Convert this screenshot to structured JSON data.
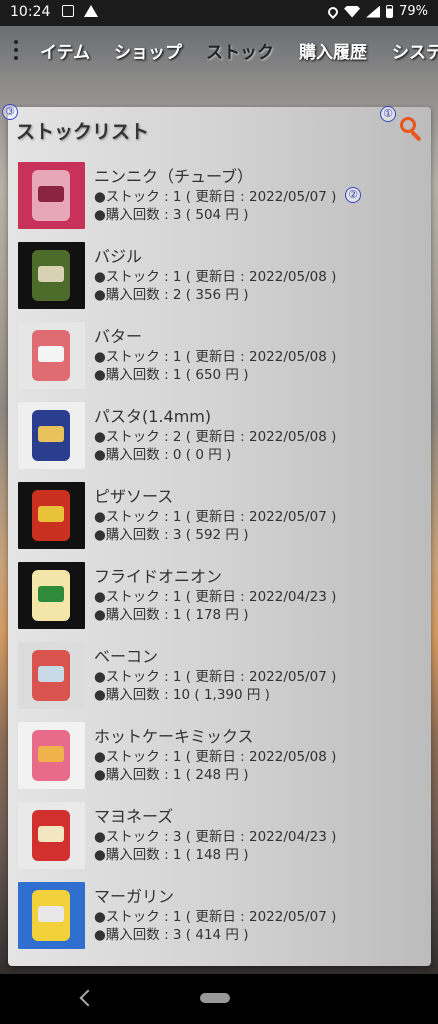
{
  "status": {
    "time": "10:24",
    "battery": "79%"
  },
  "tabs": [
    {
      "label": "イテム"
    },
    {
      "label": "ショップ"
    },
    {
      "label": "ストック",
      "active": true
    },
    {
      "label": "購入履歴"
    },
    {
      "label": "システ"
    }
  ],
  "panel": {
    "title": "ストックリスト",
    "markers": [
      "①",
      "②",
      "③"
    ]
  },
  "items": [
    {
      "name": "ニンニク（チューブ）",
      "stock": "●ストック : 1 ( 更新日 : 2022/05/07 )",
      "purchases": "●購入回数 : 3 ( 504 円 )",
      "thumb_colors": [
        "#c8325a",
        "#e8a7b8",
        "#8a2440"
      ]
    },
    {
      "name": "バジル",
      "stock": "●ストック : 1 ( 更新日 : 2022/05/08 )",
      "purchases": "●購入回数 : 2 ( 356 円 )",
      "thumb_colors": [
        "#111111",
        "#4d6b2a",
        "#d8d2b5"
      ]
    },
    {
      "name": "バター",
      "stock": "●ストック : 1 ( 更新日 : 2022/05/08 )",
      "purchases": "●購入回数 : 1 ( 650 円 )",
      "thumb_colors": [
        "#e6e6e6",
        "#e06c73",
        "#f4f4f4"
      ]
    },
    {
      "name": "パスタ(1.4mm)",
      "stock": "●ストック : 2 ( 更新日 : 2022/05/08 )",
      "purchases": "●購入回数 : 0 ( 0 円 )",
      "thumb_colors": [
        "#efefef",
        "#2a3d8f",
        "#e8c25a"
      ]
    },
    {
      "name": "ピザソース",
      "stock": "●ストック : 1 ( 更新日 : 2022/05/07 )",
      "purchases": "●購入回数 : 3 ( 592 円 )",
      "thumb_colors": [
        "#111111",
        "#c9301f",
        "#e8c33a"
      ]
    },
    {
      "name": "フライドオニオン",
      "stock": "●ストック : 1 ( 更新日 : 2022/04/23 )",
      "purchases": "●購入回数 : 1 ( 178 円 )",
      "thumb_colors": [
        "#111111",
        "#f4e6a8",
        "#2f8a3a"
      ]
    },
    {
      "name": "ベーコン",
      "stock": "●ストック : 1 ( 更新日 : 2022/05/07 )",
      "purchases": "●購入回数 : 10 ( 1,390 円 )",
      "thumb_colors": [
        "#dcdcdc",
        "#d9534f",
        "#c8d9e8"
      ]
    },
    {
      "name": "ホットケーキミックス",
      "stock": "●ストック : 1 ( 更新日 : 2022/05/08 )",
      "purchases": "●購入回数 : 1 ( 248 円 )",
      "thumb_colors": [
        "#f2f2f2",
        "#e86c8a",
        "#f0b24a"
      ]
    },
    {
      "name": "マヨネーズ",
      "stock": "●ストック : 3 ( 更新日 : 2022/04/23 )",
      "purchases": "●購入回数 : 1 ( 148 円 )",
      "thumb_colors": [
        "#e9e9e9",
        "#d22f2f",
        "#f3e7c2"
      ]
    },
    {
      "name": "マーガリン",
      "stock": "●ストック : 1 ( 更新日 : 2022/05/07 )",
      "purchases": "●購入回数 : 3 ( 414 円 )",
      "thumb_colors": [
        "#2e6fd0",
        "#f2d13a",
        "#e8e8e8"
      ]
    }
  ],
  "colors": {
    "accent": "#e8551b",
    "marker": "#3b46c9"
  }
}
